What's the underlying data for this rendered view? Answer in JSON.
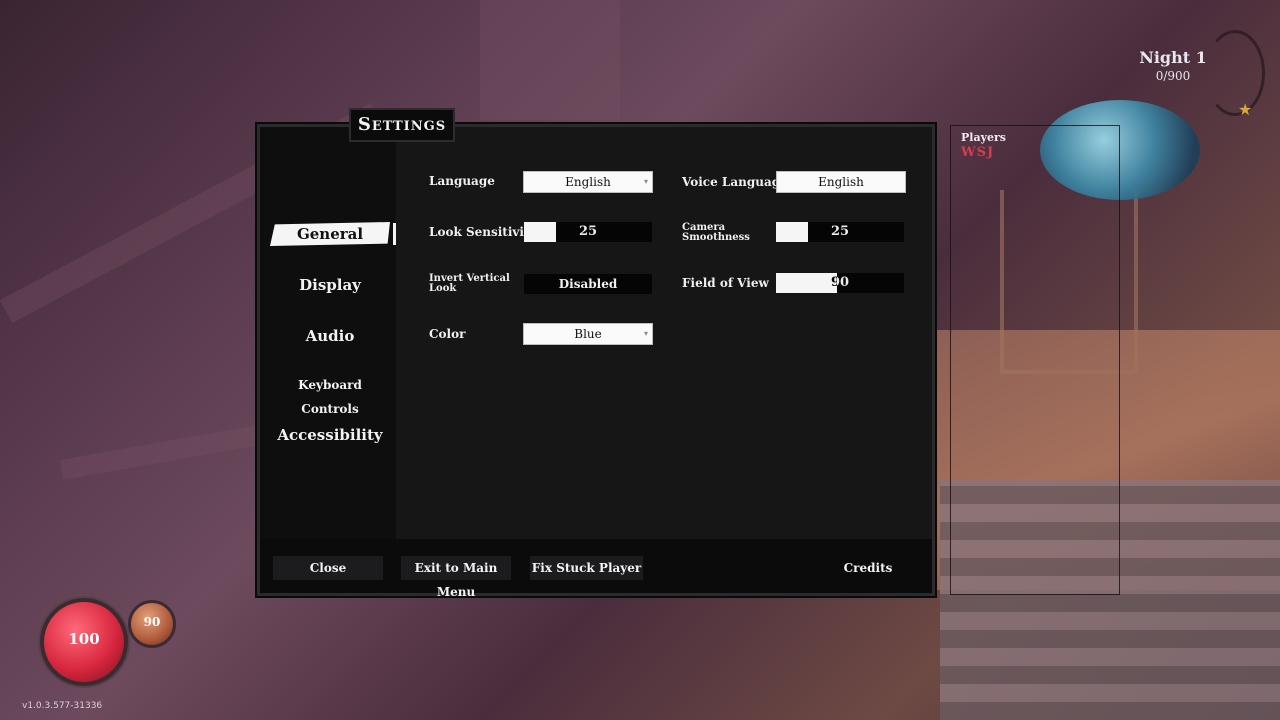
{
  "hud": {
    "night_title": "Night 1",
    "night_progress": "0/900",
    "players_label": "Players",
    "player_name": "WSJ",
    "health": "100",
    "stamina": "90",
    "version": "v1.0.3.577-31336"
  },
  "settings": {
    "title": "Settings",
    "nav": [
      "General",
      "Display",
      "Audio",
      "Keyboard Controls",
      "Accessibility"
    ],
    "active_nav": "General",
    "options": {
      "language_label": "Language",
      "language_value": "English",
      "voice_language_label": "Voice Language",
      "voice_language_value": "English",
      "look_sensitivity_label": "Look Sensitivity",
      "look_sensitivity_value": "25",
      "camera_smoothness_label_1": "Camera",
      "camera_smoothness_label_2": "Smoothness",
      "camera_smoothness_value": "25",
      "invert_vertical_label_1": "Invert Vertical",
      "invert_vertical_label_2": "Look",
      "invert_vertical_value": "Disabled",
      "fov_label": "Field of View",
      "fov_value": "90",
      "color_label": "Color",
      "color_value": "Blue"
    },
    "footer": {
      "close": "Close",
      "exit_main_menu": "Exit to Main Menu",
      "fix_stuck_player": "Fix Stuck Player",
      "credits": "Credits"
    }
  },
  "colors": {
    "panel_bg": "#121213",
    "accent_white": "#f5f5f5",
    "health_red": "#d9283f",
    "stamina_orange": "#b05a3a",
    "player_name_red": "#d63c4e"
  },
  "sliders": {
    "look_sensitivity_fraction": 0.25,
    "camera_smoothness_fraction": 0.25,
    "fov_fraction": 0.48
  }
}
